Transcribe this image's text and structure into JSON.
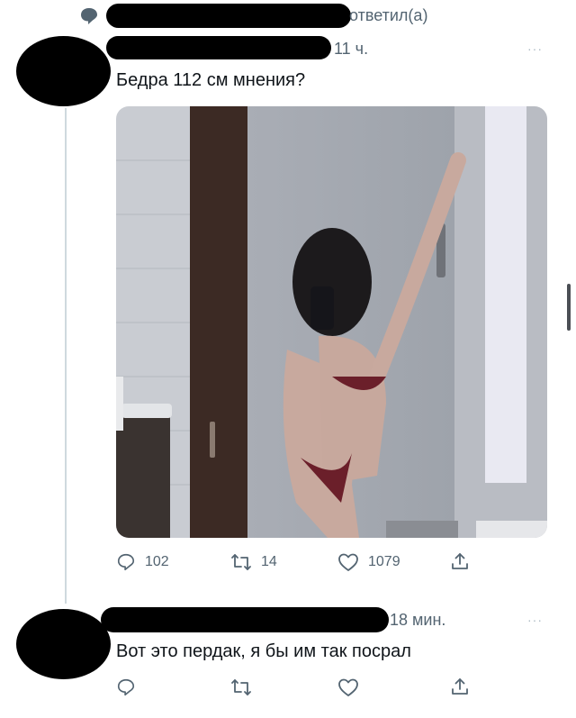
{
  "header": {
    "replied_label": "ответил(а)"
  },
  "tweet1": {
    "time": "11 ч.",
    "text": "Бедра 112 см мнения?",
    "more": "···",
    "stats": {
      "replies": "102",
      "retweets": "14",
      "likes": "1079"
    }
  },
  "tweet2": {
    "time": "18 мин.",
    "text": "Вот это пердак, я бы им так посрал",
    "more": "···"
  },
  "colors": {
    "muted": "#536471",
    "line": "#cfd9de",
    "redaction": "#000000"
  }
}
